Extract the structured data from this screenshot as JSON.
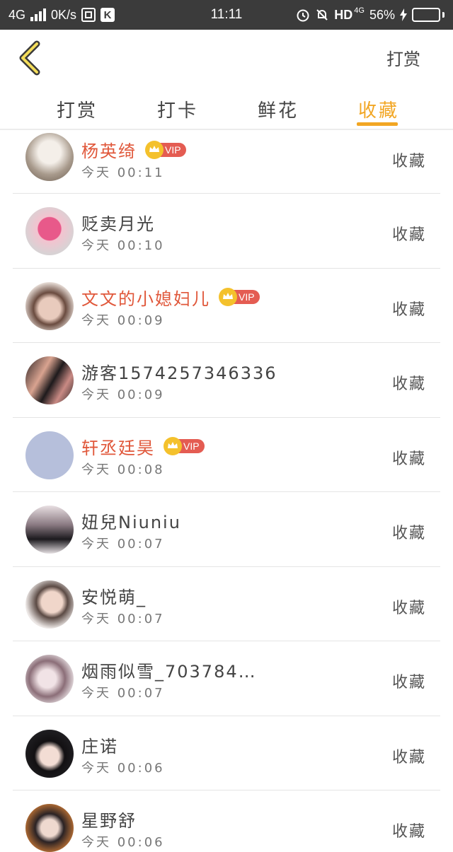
{
  "status_bar": {
    "network": "4G",
    "speed": "0K/s",
    "time": "11:11",
    "hd_label": "HD",
    "hd_net": "4G",
    "battery_text": "56%",
    "battery_level": 0.56
  },
  "header": {
    "action_label": "打赏"
  },
  "tabs": [
    {
      "label": "打赏",
      "active": false
    },
    {
      "label": "打卡",
      "active": false
    },
    {
      "label": "鲜花",
      "active": false
    },
    {
      "label": "收藏",
      "active": true
    }
  ],
  "colors": {
    "accent": "#f2a623",
    "vip_name": "#e0573a",
    "vip_badge": "#e45c52",
    "crown": "#f4c12c"
  },
  "vip_badge_label": "VIP",
  "users": [
    {
      "name": "杨英绮",
      "vip": true,
      "time": "今天 00:11",
      "action": "收藏"
    },
    {
      "name": "贬卖月光",
      "vip": false,
      "time": "今天 00:10",
      "action": "收藏"
    },
    {
      "name": "文文的小媳妇儿",
      "vip": true,
      "time": "今天 00:09",
      "action": "收藏"
    },
    {
      "name": "游客1574257346336",
      "vip": false,
      "time": "今天 00:09",
      "action": "收藏"
    },
    {
      "name": "轩丞廷昊",
      "vip": true,
      "time": "今天 00:08",
      "action": "收藏"
    },
    {
      "name": "妞兒Niuniu",
      "vip": false,
      "time": "今天 00:07",
      "action": "收藏"
    },
    {
      "name": "安悦萌_",
      "vip": false,
      "time": "今天 00:07",
      "action": "收藏"
    },
    {
      "name": "烟雨似雪_703784…",
      "vip": false,
      "time": "今天 00:07",
      "action": "收藏"
    },
    {
      "name": "庄诺",
      "vip": false,
      "time": "今天 00:06",
      "action": "收藏"
    },
    {
      "name": "星野舒",
      "vip": false,
      "time": "今天 00:06",
      "action": "收藏"
    }
  ]
}
